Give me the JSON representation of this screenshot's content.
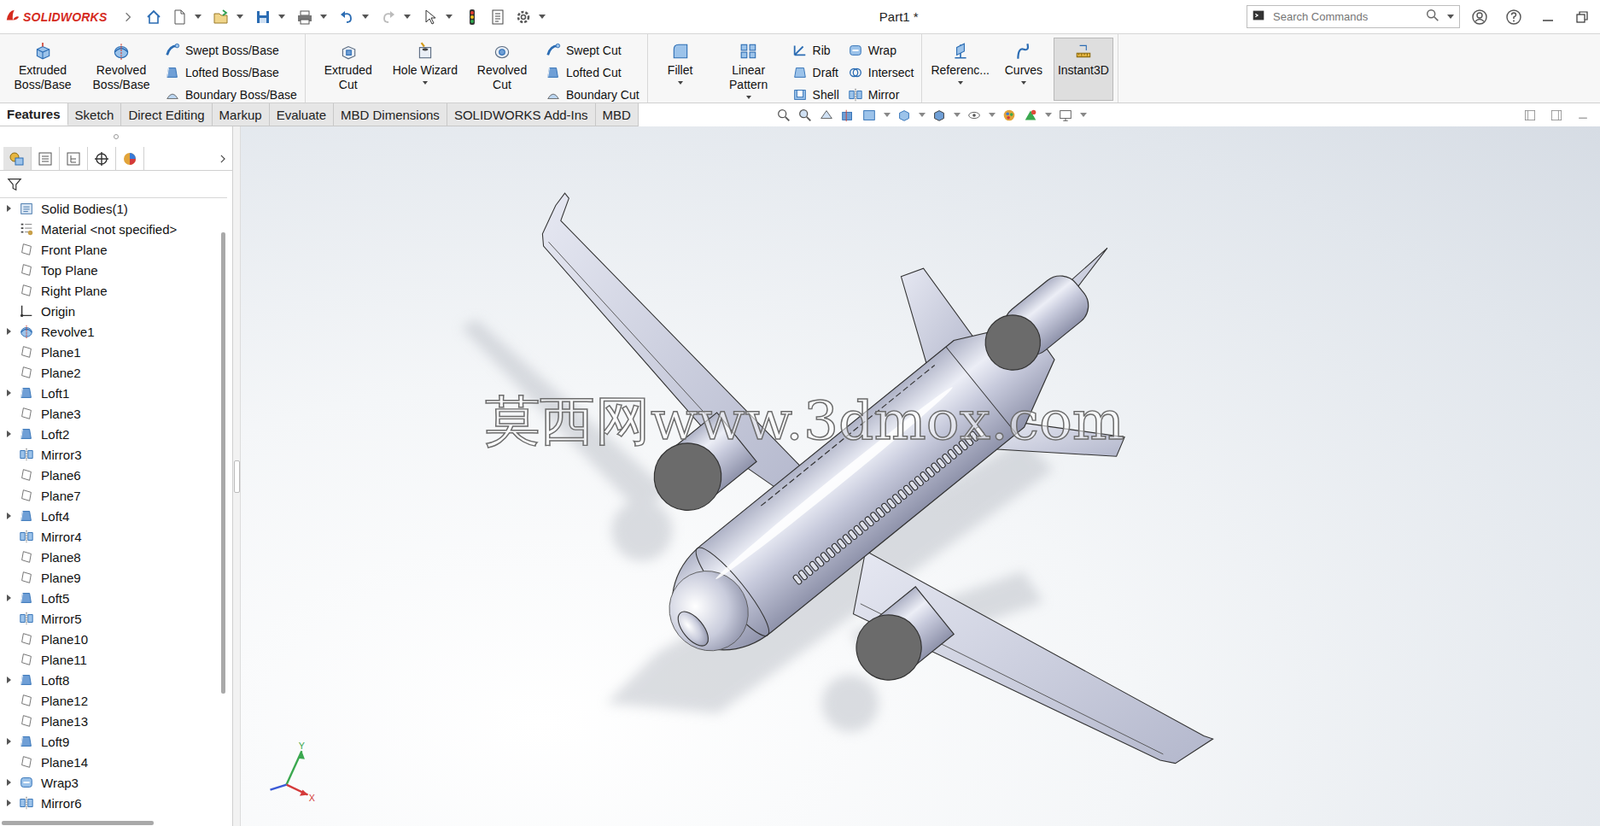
{
  "window": {
    "title": "Part1 *",
    "logo": "SOLIDWORKS"
  },
  "search": {
    "placeholder": "Search Commands"
  },
  "ribbon": {
    "groups": [
      {
        "large": [
          {
            "label": "Extruded Boss/Base",
            "kind": "extrude",
            "dropdown": false,
            "active": false
          },
          {
            "label": "Revolved Boss/Base",
            "kind": "revolve",
            "dropdown": false,
            "active": false
          }
        ],
        "small": [
          [
            {
              "label": "Swept Boss/Base",
              "kind": "sweep"
            },
            {
              "label": "Lofted Boss/Base",
              "kind": "loft"
            },
            {
              "label": "Boundary Boss/Base",
              "kind": "boundary"
            }
          ]
        ]
      },
      {
        "large": [
          {
            "label": "Extruded Cut",
            "kind": "extrudecut",
            "dropdown": false,
            "active": false
          },
          {
            "label": "Hole Wizard",
            "kind": "hole",
            "dropdown": true,
            "active": false
          },
          {
            "label": "Revolved Cut",
            "kind": "revolvecut",
            "dropdown": false,
            "active": false
          }
        ],
        "small": [
          [
            {
              "label": "Swept Cut",
              "kind": "sweep"
            },
            {
              "label": "Lofted Cut",
              "kind": "loft"
            },
            {
              "label": "Boundary Cut",
              "kind": "boundary"
            }
          ]
        ]
      },
      {
        "large": [
          {
            "label": "Fillet",
            "kind": "fillet",
            "dropdown": true,
            "active": false
          },
          {
            "label": "Linear Pattern",
            "kind": "pattern",
            "dropdown": true,
            "active": false
          }
        ],
        "small": [
          [
            {
              "label": "Rib",
              "kind": "rib"
            },
            {
              "label": "Draft",
              "kind": "draft"
            },
            {
              "label": "Shell",
              "kind": "shell"
            }
          ],
          [
            {
              "label": "Wrap",
              "kind": "wrap"
            },
            {
              "label": "Intersect",
              "kind": "intersect"
            },
            {
              "label": "Mirror",
              "kind": "mirror"
            }
          ]
        ]
      },
      {
        "large": [
          {
            "label": "Referenc...",
            "kind": "reference",
            "dropdown": true,
            "active": false
          },
          {
            "label": "Curves",
            "kind": "curves",
            "dropdown": true,
            "active": false
          },
          {
            "label": "Instant3D",
            "kind": "instant3d",
            "dropdown": false,
            "active": true
          }
        ],
        "small": []
      }
    ]
  },
  "tabs": [
    {
      "label": "Features",
      "selected": true
    },
    {
      "label": "Sketch",
      "selected": false
    },
    {
      "label": "Direct Editing",
      "selected": false
    },
    {
      "label": "Markup",
      "selected": false
    },
    {
      "label": "Evaluate",
      "selected": false
    },
    {
      "label": "MBD Dimensions",
      "selected": false
    },
    {
      "label": "SOLIDWORKS Add-Ins",
      "selected": false
    },
    {
      "label": "MBD",
      "selected": false
    }
  ],
  "tree": {
    "items": [
      {
        "label": "Solid Bodies(1)",
        "kind": "folder",
        "expandable": true
      },
      {
        "label": "Material <not specified>",
        "kind": "material",
        "expandable": false
      },
      {
        "label": "Front Plane",
        "kind": "plane",
        "expandable": false
      },
      {
        "label": "Top Plane",
        "kind": "plane",
        "expandable": false
      },
      {
        "label": "Right Plane",
        "kind": "plane",
        "expandable": false
      },
      {
        "label": "Origin",
        "kind": "origin",
        "expandable": false
      },
      {
        "label": "Revolve1",
        "kind": "revolve",
        "expandable": true
      },
      {
        "label": "Plane1",
        "kind": "plane",
        "expandable": false
      },
      {
        "label": "Plane2",
        "kind": "plane",
        "expandable": false
      },
      {
        "label": "Loft1",
        "kind": "loft",
        "expandable": true
      },
      {
        "label": "Plane3",
        "kind": "plane",
        "expandable": false
      },
      {
        "label": "Loft2",
        "kind": "loft",
        "expandable": true
      },
      {
        "label": "Mirror3",
        "kind": "mirror",
        "expandable": false
      },
      {
        "label": "Plane6",
        "kind": "plane",
        "expandable": false
      },
      {
        "label": "Plane7",
        "kind": "plane",
        "expandable": false
      },
      {
        "label": "Loft4",
        "kind": "loft",
        "expandable": true
      },
      {
        "label": "Mirror4",
        "kind": "mirror",
        "expandable": false
      },
      {
        "label": "Plane8",
        "kind": "plane",
        "expandable": false
      },
      {
        "label": "Plane9",
        "kind": "plane",
        "expandable": false
      },
      {
        "label": "Loft5",
        "kind": "loft",
        "expandable": true
      },
      {
        "label": "Mirror5",
        "kind": "mirror",
        "expandable": false
      },
      {
        "label": "Plane10",
        "kind": "plane",
        "expandable": false
      },
      {
        "label": "Plane11",
        "kind": "plane",
        "expandable": false
      },
      {
        "label": "Loft8",
        "kind": "loft",
        "expandable": true
      },
      {
        "label": "Plane12",
        "kind": "plane",
        "expandable": false
      },
      {
        "label": "Plane13",
        "kind": "plane",
        "expandable": false
      },
      {
        "label": "Loft9",
        "kind": "loft",
        "expandable": true
      },
      {
        "label": "Plane14",
        "kind": "plane",
        "expandable": false
      },
      {
        "label": "Wrap3",
        "kind": "wrap",
        "expandable": true
      },
      {
        "label": "Mirror6",
        "kind": "mirror",
        "expandable": true
      }
    ]
  },
  "viewport": {
    "watermark": "莫西网www.3dmox.com",
    "axes": [
      {
        "label": "Y"
      },
      {
        "label": "X"
      }
    ]
  }
}
